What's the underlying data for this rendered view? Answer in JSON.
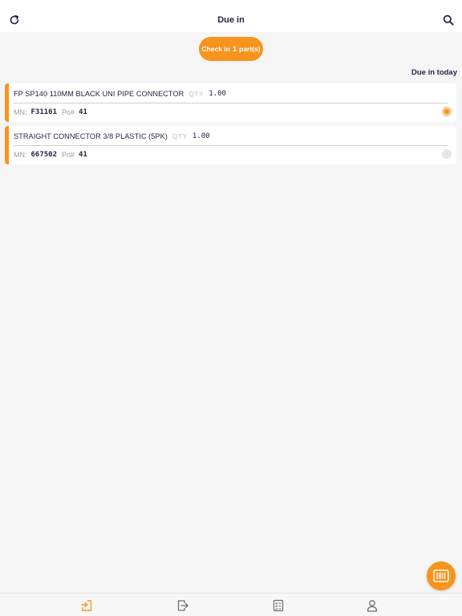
{
  "header": {
    "title": "Due in",
    "refresh_icon": "refresh-icon",
    "search_icon": "search-icon"
  },
  "checkin": {
    "prefix": "Check in",
    "count": "1",
    "suffix": "part(s)"
  },
  "section": {
    "label": "Due in today"
  },
  "items": [
    {
      "name": "FP SP140 110MM BLACK UNI PIPE CONNECTOR",
      "qty_label": "QTY",
      "qty": "1.00",
      "mn_label": "MN:",
      "mn": "F31161",
      "po_label": "Po#",
      "po": "41",
      "selected": true
    },
    {
      "name": "STRAIGHT CONNECTOR 3/8 PLASTIC (5PK)",
      "qty_label": "QTY",
      "qty": "1.00",
      "mn_label": "MN:",
      "mn": "667502",
      "po_label": "Po#",
      "po": "41",
      "selected": false
    }
  ],
  "fab": {
    "icon": "barcode-scanner-icon"
  },
  "tabs": [
    {
      "icon": "check-in-icon",
      "active": true
    },
    {
      "icon": "check-out-icon",
      "active": false
    },
    {
      "icon": "checklist-icon",
      "active": false
    },
    {
      "icon": "profile-icon",
      "active": false
    }
  ],
  "colors": {
    "accent": "#f7941d",
    "title": "#1f2340",
    "background": "#f5f5f5",
    "tab_inactive": "#6b6b6b"
  }
}
